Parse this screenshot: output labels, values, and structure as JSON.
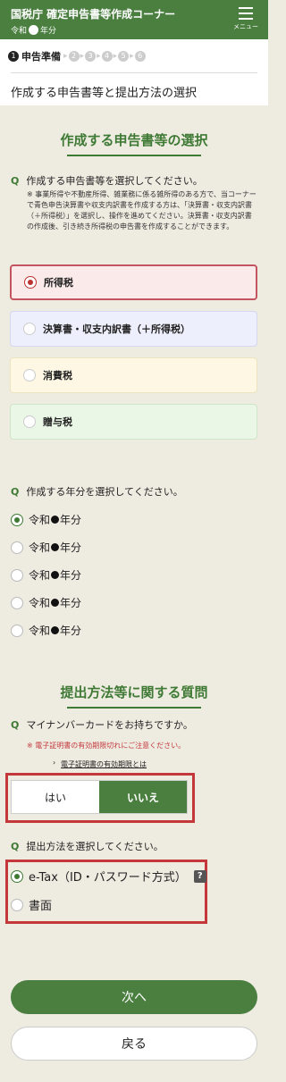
{
  "header": {
    "title": "国税庁 確定申告書等作成コーナー",
    "era_left": "令和",
    "era_right": "年分",
    "menu_label": "メニュー"
  },
  "steps": {
    "current_num": "1",
    "current_label": "申告準備",
    "others": [
      "2",
      "3",
      "4",
      "5",
      "6"
    ]
  },
  "page_title": "作成する申告書等と提出方法の選択",
  "section1": {
    "title": "作成する申告書等の選択",
    "q_mark": "Q",
    "question": "作成する申告書等を選択してください。",
    "note": "※ 事業所得や不動産所得、雑業務に係る雑所得のある方で、当コーナーで青色申告決算書や収支内訳書を作成する方は、「決算書・収支内訳書（＋所得税）」を選択し、操作を進めてください。決算書・収支内訳書の作成後、引き続き所得税の申告書を作成することができます。",
    "options": [
      "所得税",
      "決算書・収支内訳書（＋所得税）",
      "消費税",
      "贈与税"
    ]
  },
  "section_year": {
    "q_mark": "Q",
    "question": "作成する年分を選択してください。",
    "prefix": "令和",
    "suffix": "年分"
  },
  "section2": {
    "title": "提出方法等に関する質問",
    "q_mark": "Q",
    "question": "マイナンバーカードをお持ちですか。",
    "warning": "※ 電子証明書の有効期限切れにご注意ください。",
    "link_arrow": "›",
    "link": "電子証明書の有効期限とは",
    "yes": "はい",
    "no": "いいえ",
    "q2_mark": "Q",
    "question2": "提出方法を選択してください。",
    "methods": [
      "e-Tax（ID・パスワード方式）",
      "書面"
    ],
    "help": "?"
  },
  "buttons": {
    "next": "次へ",
    "back": "戻る"
  }
}
